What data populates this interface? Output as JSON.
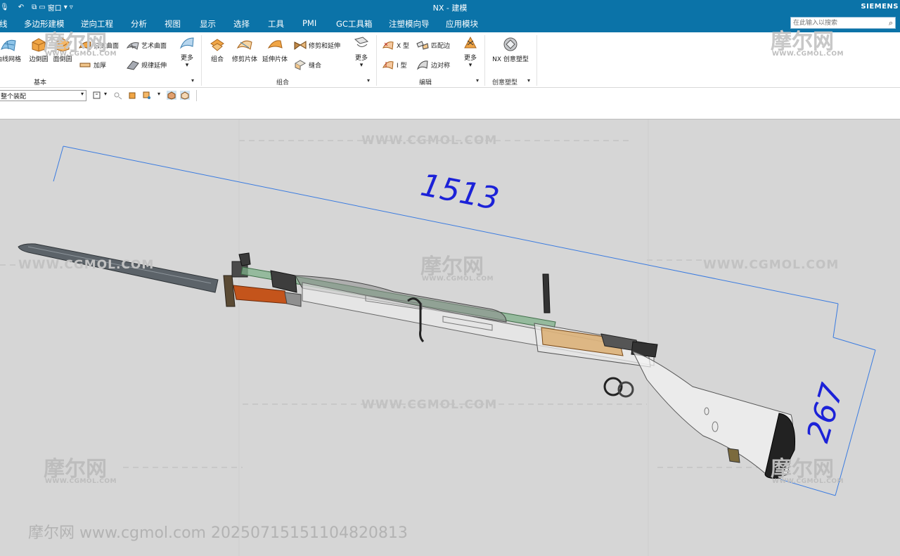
{
  "window": {
    "title": "NX - 建模",
    "brand": "SIEMENS",
    "quick_access": {
      "window_label": "窗口"
    }
  },
  "menu": [
    "线",
    "多边形建模",
    "逆向工程",
    "分析",
    "视图",
    "显示",
    "选择",
    "工具",
    "PMI",
    "GC工具箱",
    "注塑模向导",
    "应用模块"
  ],
  "search": {
    "placeholder": "在此输入以搜索"
  },
  "ribbon": {
    "groups": {
      "basic": "基本",
      "combine": "组合",
      "edit": "编辑",
      "creative": "创意塑型"
    },
    "basic": {
      "mesh_curves": "曲线网格",
      "edge_blend": "边倒圆",
      "face_blend": "面倒圆",
      "variable_sweep": "扫掠曲面",
      "thicken": "加厚",
      "studio_surface": "艺术曲面",
      "law_extension": "规律延伸",
      "more": "更多"
    },
    "combine": {
      "unite": "组合",
      "trim_sheet": "修剪片体",
      "extend_sheet": "延伸片体",
      "trim_extend": "修剪和延伸",
      "sew": "缝合",
      "more": "更多"
    },
    "edit": {
      "x_form": "X 型",
      "i_form": "I 型",
      "match_edge": "匹配边",
      "edge_symmetry": "边对称",
      "more": "更多"
    },
    "creative": {
      "nx_realize": "NX 创意塑型"
    }
  },
  "selection_bar": {
    "scope": "整个装配"
  },
  "watermarks": {
    "logo": "摩尔网",
    "url": "WWW.CGMOL.COM",
    "stamp": "摩尔网 www.cgmol.com 20250715151104820813"
  },
  "dimensions": {
    "length": "1513",
    "height": "267"
  },
  "colors": {
    "titlebar": "#0b73a8",
    "dimension": "#1c22d8",
    "viewport": "#d6d6d6"
  }
}
